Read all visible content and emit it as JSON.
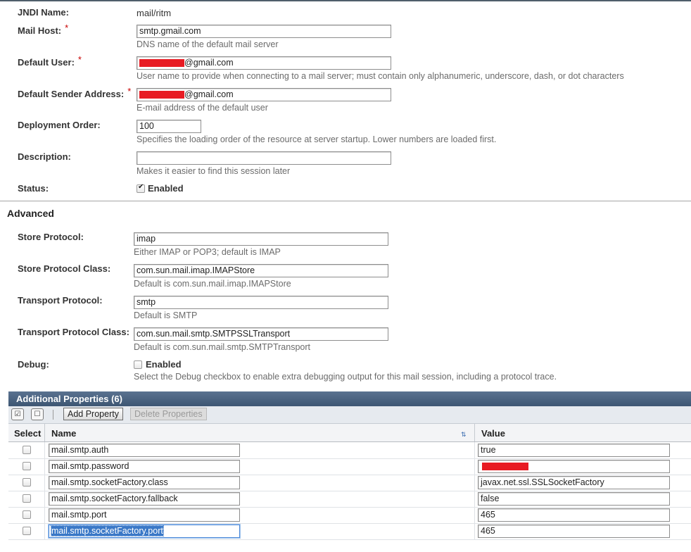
{
  "general": {
    "jndi_name_label": "JNDI Name:",
    "jndi_name_value": "mail/ritm",
    "mail_host_label": "Mail Host:",
    "mail_host_value": "smtp.gmail.com",
    "mail_host_help": "DNS name of the default mail server",
    "default_user_label": "Default User:",
    "default_user_suffix": "@gmail.com",
    "default_user_help": "User name to provide when connecting to a mail server; must contain only alphanumeric, underscore, dash, or dot characters",
    "sender_label": "Default Sender Address:",
    "sender_suffix": "@gmail.com",
    "sender_help": "E-mail address of the default user",
    "deploy_order_label": "Deployment Order:",
    "deploy_order_value": "100",
    "deploy_order_help": "Specifies the loading order of the resource at server startup. Lower numbers are loaded first.",
    "description_label": "Description:",
    "description_value": "",
    "description_help": "Makes it easier to find this session later",
    "status_label": "Status:",
    "status_checkbox_label": "Enabled",
    "status_checked": true,
    "required_marker": "*"
  },
  "advanced": {
    "title": "Advanced",
    "store_protocol_label": "Store Protocol:",
    "store_protocol_value": "imap",
    "store_protocol_help": "Either IMAP or POP3; default is IMAP",
    "store_class_label": "Store Protocol Class:",
    "store_class_value": "com.sun.mail.imap.IMAPStore",
    "store_class_help": "Default is com.sun.mail.imap.IMAPStore",
    "transport_protocol_label": "Transport Protocol:",
    "transport_protocol_value": "smtp",
    "transport_protocol_help": "Default is SMTP",
    "transport_class_label": "Transport Protocol Class:",
    "transport_class_value": "com.sun.mail.smtp.SMTPSSLTransport",
    "transport_class_help": "Default is com.sun.mail.smtp.SMTPTransport",
    "debug_label": "Debug:",
    "debug_checkbox_label": "Enabled",
    "debug_checked": false,
    "debug_help": "Select the Debug checkbox to enable extra debugging output for this mail session, including a protocol trace."
  },
  "properties": {
    "title": "Additional Properties (6)",
    "add_button": "Add Property",
    "delete_button": "Delete Properties",
    "columns": {
      "select": "Select",
      "name": "Name",
      "value": "Value"
    },
    "rows": [
      {
        "name": "mail.smtp.auth",
        "value": "true"
      },
      {
        "name": "mail.smtp.password",
        "value": ""
      },
      {
        "name": "mail.smtp.socketFactory.class",
        "value": "javax.net.ssl.SSLSocketFactory"
      },
      {
        "name": "mail.smtp.socketFactory.fallback",
        "value": "false"
      },
      {
        "name": "mail.smtp.port",
        "value": "465"
      },
      {
        "name": "mail.smtp.socketFactory.port",
        "value": "465"
      }
    ]
  },
  "colors": {
    "required": "#c80000",
    "table_header": "#3d5673",
    "redaction": "#e81b23"
  },
  "icons": {
    "select_all": "select-all-icon",
    "deselect_all": "deselect-all-icon",
    "sort": "sort-icon"
  }
}
